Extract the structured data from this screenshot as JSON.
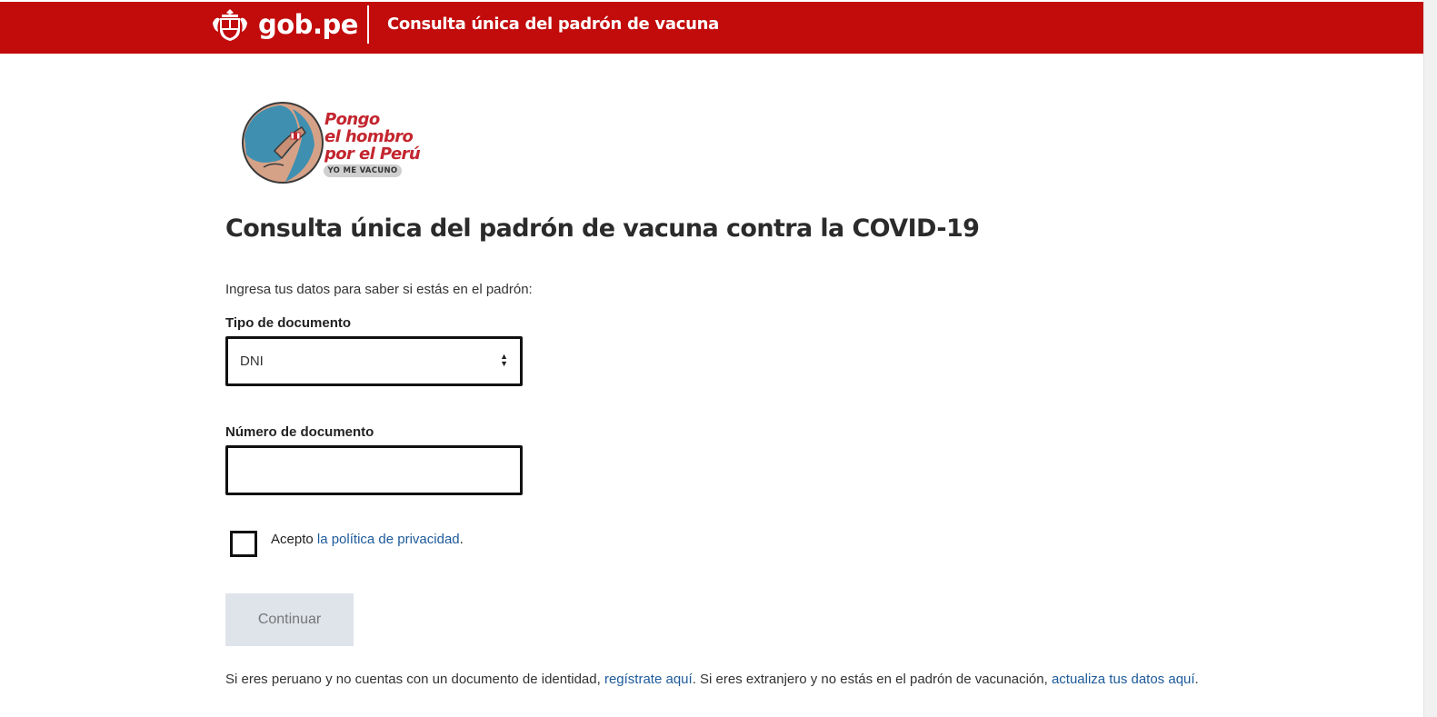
{
  "header": {
    "brand": "gob.pe",
    "site_title": "Consulta única del padrón de vacuna"
  },
  "campaign": {
    "line1": "Pongo",
    "line2": "el hombro",
    "line3": "por el Perú",
    "pill": "YO ME VACUNO"
  },
  "page": {
    "title": "Consulta única del padrón de vacuna contra la COVID-19",
    "intro": "Ingresa tus datos para saber si estás en el padrón:"
  },
  "form": {
    "doc_type_label": "Tipo de documento",
    "doc_type_value": "DNI",
    "doc_number_label": "Número de documento",
    "doc_number_value": "",
    "accept_prefix": "Acepto ",
    "privacy_link": "la política de privacidad",
    "accept_suffix": ".",
    "continue_label": "Continuar"
  },
  "footer": {
    "text1": "Si eres peruano y no cuentas con un documento de identidad, ",
    "link1": "regístrate aquí",
    "text2": ". Si eres extranjero y no estás en el padrón de vacunación, ",
    "link2": "actualiza tus datos aquí",
    "text3": "."
  },
  "colors": {
    "header_red": "#c20b0b",
    "link_blue": "#1d5a9a",
    "campaign_red": "#c3262f",
    "button_disabled_bg": "#dfe3ea"
  },
  "icons": {
    "emblem": "peru-coat-of-arms-icon",
    "select_arrows": "sort-arrows-icon"
  }
}
